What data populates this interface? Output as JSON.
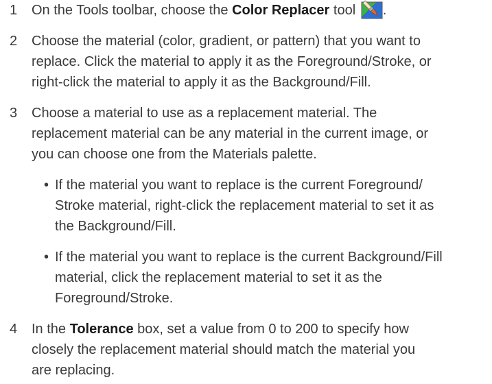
{
  "steps": [
    {
      "number": "1",
      "text_before": "On the Tools toolbar, choose the ",
      "bold": "Color Replacer",
      "text_after": " tool",
      "icon": "color-replacer-icon",
      "text_end": "."
    },
    {
      "number": "2",
      "lines": [
        "Choose the material (color, gradient, or pattern) that you want to",
        "replace. Click the material to apply it as the Foreground/Stroke, or",
        "right-click the material to apply it as the Background/Fill."
      ]
    },
    {
      "number": "3",
      "lines": [
        "Choose a material to use as a replacement material. The",
        "replacement material can be any material in the current image, or",
        "you can choose one from the Materials palette."
      ],
      "bullets": [
        {
          "lines": [
            "If the material you want to replace is the current Foreground/",
            "Stroke material, right-click the replacement material to set it as",
            "the Background/Fill."
          ]
        },
        {
          "lines": [
            "If the material you want to replace is the current Background/Fill",
            "material, click the replacement material to set it as the",
            "Foreground/Stroke."
          ]
        }
      ]
    },
    {
      "number": "4",
      "text_before": "In the ",
      "bold": "Tolerance",
      "lines": [
        " box, set a value from 0 to 200 to specify how",
        "closely the replacement material should match the material you",
        "are replacing."
      ]
    }
  ],
  "bullet_char": "•",
  "colors": {
    "text": "#3a3a3a",
    "bold": "#1a1a1a"
  }
}
